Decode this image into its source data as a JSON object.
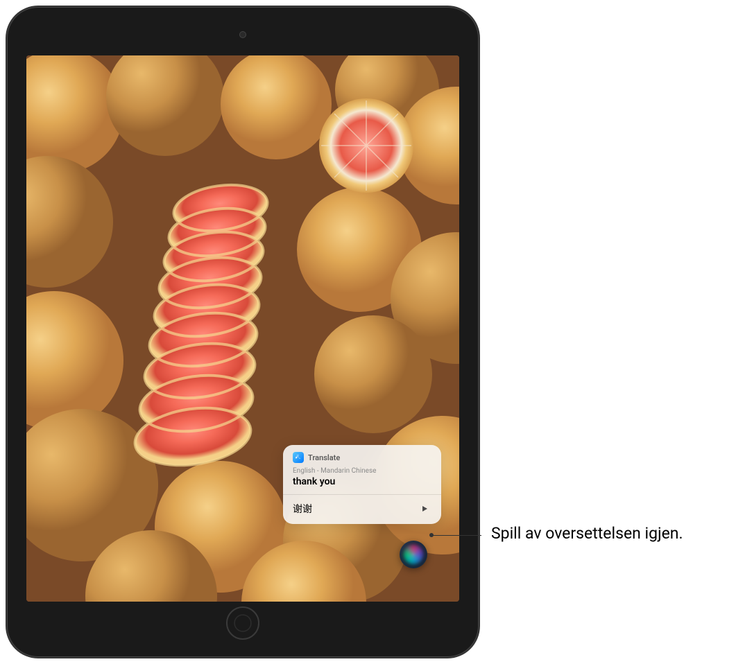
{
  "siri_card": {
    "app_name": "Translate",
    "languages": "English - Mandarin Chinese",
    "source_text": "thank you",
    "translated_text": "谢谢",
    "icon_name": "translate-icon",
    "play_icon_name": "play-icon"
  },
  "callout": {
    "text": "Spill av oversettelsen igjen."
  },
  "device": {
    "type": "iPad"
  }
}
